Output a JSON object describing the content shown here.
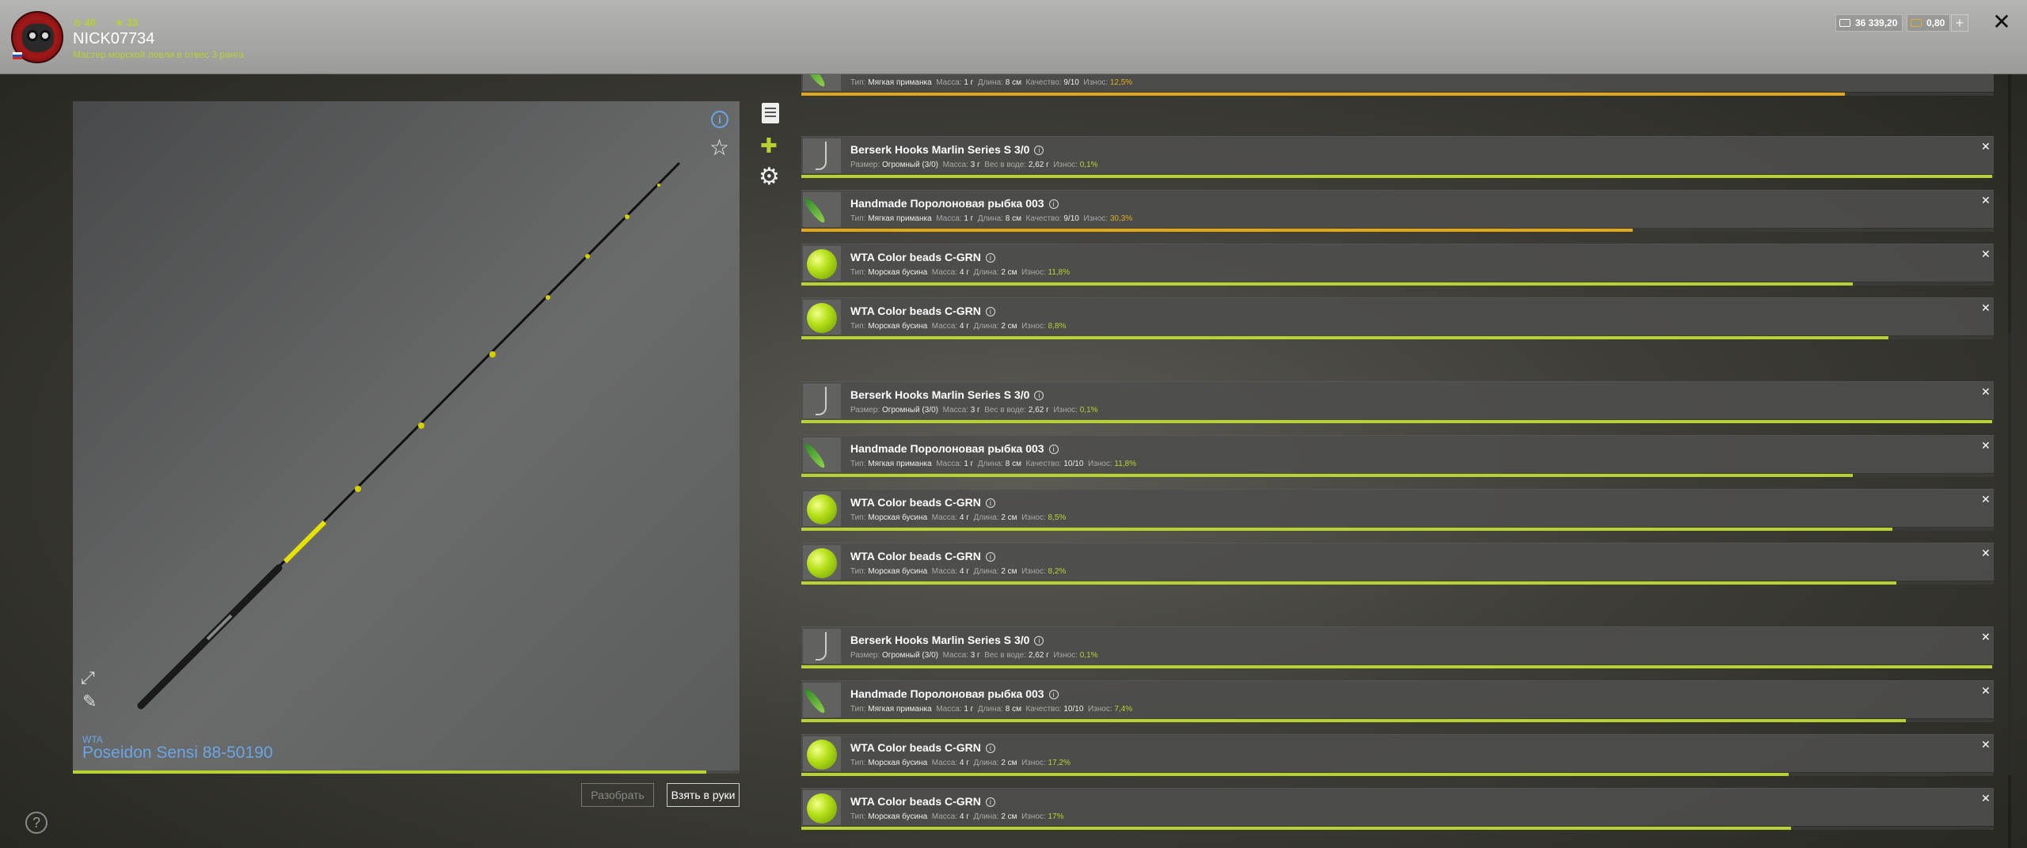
{
  "header": {
    "stat_level": "40",
    "stat_rank": "33",
    "player_name": "NICK07734",
    "player_title": "Мастер морской ловли в отвес 3 ранга",
    "money": "36 339,20",
    "gold": "0,80",
    "plus_label": "+",
    "close_label": "✕"
  },
  "rod": {
    "brand": "WTA",
    "name": "Poseidon Sensi 88-50190",
    "condition": 0.95,
    "info_label": "i",
    "btn_disassemble": "Разобрать",
    "btn_take": "Взять в руки"
  },
  "help_label": "?",
  "items": [
    {
      "kind": "lure",
      "name": "",
      "props": [
        [
          "Тип:",
          "Мягкая приманка"
        ],
        [
          "Масса:",
          "1 г"
        ],
        [
          "Длина:",
          "8 см"
        ],
        [
          "Качество:",
          "9/10"
        ]
      ],
      "wear_label": "Износ:",
      "wear": "12,5%",
      "wear_color": "orange",
      "bar": 0.875
    },
    {
      "kind": "hook",
      "name": "Berserk Hooks Marlin Series S 3/0",
      "props": [
        [
          "Размер:",
          "Огромный (3/0)"
        ],
        [
          "Масса:",
          "3 г"
        ],
        [
          "Вес в воде:",
          "2,62 г"
        ]
      ],
      "wear_label": "Износ:",
      "wear": "0,1%",
      "wear_color": "green",
      "bar": 0.999
    },
    {
      "kind": "lure",
      "name": "Handmade Поролоновая рыбка 003",
      "props": [
        [
          "Тип:",
          "Мягкая приманка"
        ],
        [
          "Масса:",
          "1 г"
        ],
        [
          "Длина:",
          "8 см"
        ],
        [
          "Качество:",
          "9/10"
        ]
      ],
      "wear_label": "Износ:",
      "wear": "30,3%",
      "wear_color": "orange",
      "bar": 0.697
    },
    {
      "kind": "bead",
      "name": "WTA Color beads C-GRN",
      "props": [
        [
          "Тип:",
          "Морская бусина"
        ],
        [
          "Масса:",
          "4 г"
        ],
        [
          "Длина:",
          "2 см"
        ]
      ],
      "wear_label": "Износ:",
      "wear": "11,8%",
      "wear_color": "green",
      "bar": 0.882
    },
    {
      "kind": "bead",
      "name": "WTA Color beads C-GRN",
      "props": [
        [
          "Тип:",
          "Морская бусина"
        ],
        [
          "Масса:",
          "4 г"
        ],
        [
          "Длина:",
          "2 см"
        ]
      ],
      "wear_label": "Износ:",
      "wear": "8,8%",
      "wear_color": "green",
      "bar": 0.912
    },
    {
      "kind": "hook",
      "name": "Berserk Hooks Marlin Series S 3/0",
      "props": [
        [
          "Размер:",
          "Огромный (3/0)"
        ],
        [
          "Масса:",
          "3 г"
        ],
        [
          "Вес в воде:",
          "2,62 г"
        ]
      ],
      "wear_label": "Износ:",
      "wear": "0,1%",
      "wear_color": "green",
      "bar": 0.999
    },
    {
      "kind": "lure",
      "name": "Handmade Поролоновая рыбка 003",
      "props": [
        [
          "Тип:",
          "Мягкая приманка"
        ],
        [
          "Масса:",
          "1 г"
        ],
        [
          "Длина:",
          "8 см"
        ],
        [
          "Качество:",
          "10/10"
        ]
      ],
      "wear_label": "Износ:",
      "wear": "11,8%",
      "wear_color": "green",
      "bar": 0.882
    },
    {
      "kind": "bead",
      "name": "WTA Color beads C-GRN",
      "props": [
        [
          "Тип:",
          "Морская бусина"
        ],
        [
          "Масса:",
          "4 г"
        ],
        [
          "Длина:",
          "2 см"
        ]
      ],
      "wear_label": "Износ:",
      "wear": "8,5%",
      "wear_color": "green",
      "bar": 0.915
    },
    {
      "kind": "bead",
      "name": "WTA Color beads C-GRN",
      "props": [
        [
          "Тип:",
          "Морская бусина"
        ],
        [
          "Масса:",
          "4 г"
        ],
        [
          "Длина:",
          "2 см"
        ]
      ],
      "wear_label": "Износ:",
      "wear": "8,2%",
      "wear_color": "green",
      "bar": 0.918
    },
    {
      "kind": "hook",
      "name": "Berserk Hooks Marlin Series S 3/0",
      "props": [
        [
          "Размер:",
          "Огромный (3/0)"
        ],
        [
          "Масса:",
          "3 г"
        ],
        [
          "Вес в воде:",
          "2,62 г"
        ]
      ],
      "wear_label": "Износ:",
      "wear": "0,1%",
      "wear_color": "green",
      "bar": 0.999
    },
    {
      "kind": "lure",
      "name": "Handmade Поролоновая рыбка 003",
      "props": [
        [
          "Тип:",
          "Мягкая приманка"
        ],
        [
          "Масса:",
          "1 г"
        ],
        [
          "Длина:",
          "8 см"
        ],
        [
          "Качество:",
          "10/10"
        ]
      ],
      "wear_label": "Износ:",
      "wear": "7,4%",
      "wear_color": "green",
      "bar": 0.926
    },
    {
      "kind": "bead",
      "name": "WTA Color beads C-GRN",
      "props": [
        [
          "Тип:",
          "Морская бусина"
        ],
        [
          "Масса:",
          "4 г"
        ],
        [
          "Длина:",
          "2 см"
        ]
      ],
      "wear_label": "Износ:",
      "wear": "17,2%",
      "wear_color": "green",
      "bar": 0.828
    },
    {
      "kind": "bead",
      "name": "WTA Color beads C-GRN",
      "props": [
        [
          "Тип:",
          "Морская бусина"
        ],
        [
          "Масса:",
          "4 г"
        ],
        [
          "Длина:",
          "2 см"
        ]
      ],
      "wear_label": "Износ:",
      "wear": "17%",
      "wear_color": "green",
      "bar": 0.83
    }
  ],
  "colors": {
    "accent": "#b8d232",
    "link": "#6aa6e6",
    "wear_orange": "#e0a818"
  }
}
